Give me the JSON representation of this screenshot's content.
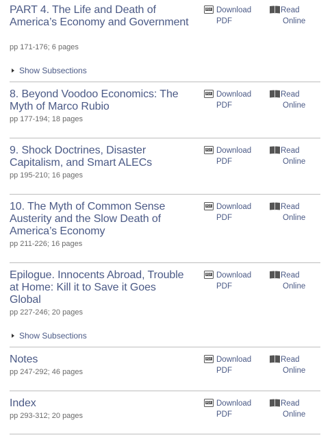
{
  "actions": {
    "download_line1": "Download",
    "download_line2": "PDF",
    "read_line1": "Read",
    "read_line2": "Online"
  },
  "show_subsections_label": "Show Subsections",
  "chapters": [
    {
      "title": "PART 4. The Life and Death of America’s Economy and Government",
      "pages": "pp 171-176; 6 pages",
      "has_subsections": true
    },
    {
      "title": "8. Beyond Voodoo Economics: The Myth of Marco Rubio",
      "pages": "pp 177-194; 18 pages",
      "has_subsections": false
    },
    {
      "title": "9. Shock Doctrines, Disaster Capitalism, and Smart ALECs",
      "pages": "pp 195-210; 16 pages",
      "has_subsections": false
    },
    {
      "title": "10. The Myth of Common Sense Austerity and the Slow Death of America’s Economy",
      "pages": "pp 211-226; 16 pages",
      "has_subsections": false
    },
    {
      "title": "Epilogue. Innocents Abroad, Trouble at Home: Kill it to Save it Goes Global",
      "pages": "pp 227-246; 20 pages",
      "has_subsections": true
    },
    {
      "title": "Notes",
      "pages": "pp 247-292; 46 pages",
      "has_subsections": false
    },
    {
      "title": "Index",
      "pages": "pp 293-312; 20 pages",
      "has_subsections": false
    }
  ],
  "colors": {
    "link": "#4b5a86",
    "text": "#6a6a6a",
    "rule": "#bdbdbd"
  },
  "icons": {
    "download": "pdf-download-icon",
    "read": "open-book-icon",
    "expand": "caret-right-icon"
  }
}
